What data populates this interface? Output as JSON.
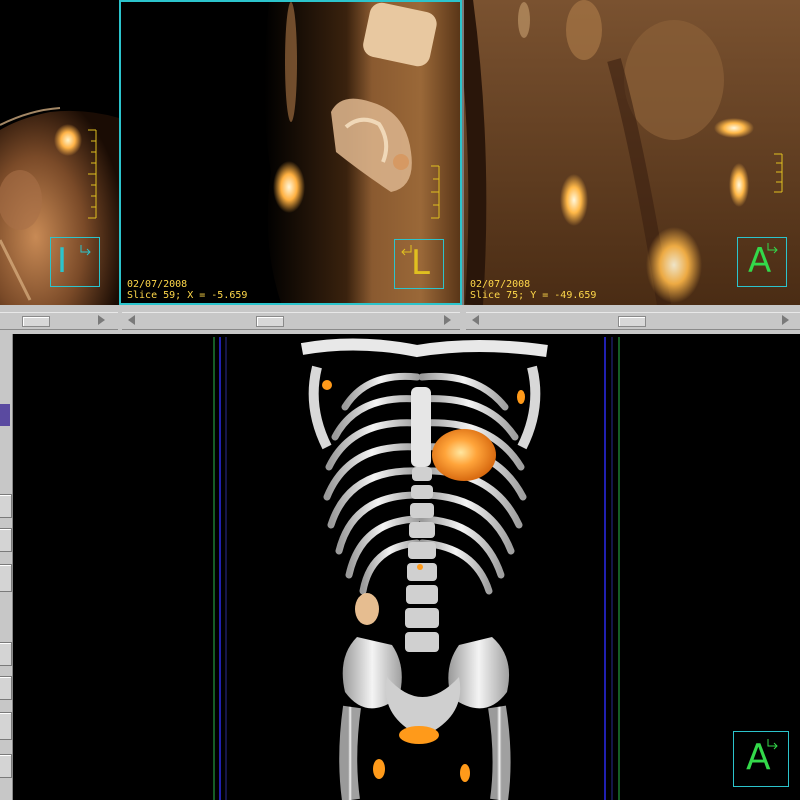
{
  "viewports": {
    "axial": {
      "orientation_letter": "I"
    },
    "sagittal": {
      "date": "02/07/2008",
      "slice_info": "Slice 59; X = -5.659",
      "orientation_letter": "L"
    },
    "coronal": {
      "date": "02/07/2008",
      "slice_info": "Slice 75; Y = -49.659",
      "orientation_letter": "A"
    },
    "render3d": {
      "orientation_letter": "A"
    }
  },
  "colors": {
    "overlay_text": "#ffd84a",
    "active_border": "#2cc4cc",
    "orient_green": "#33d94a",
    "ruler": "#e0c020",
    "scrollbar_bg": "#c7c7c7",
    "hot_spot": "#ff9a1a"
  }
}
